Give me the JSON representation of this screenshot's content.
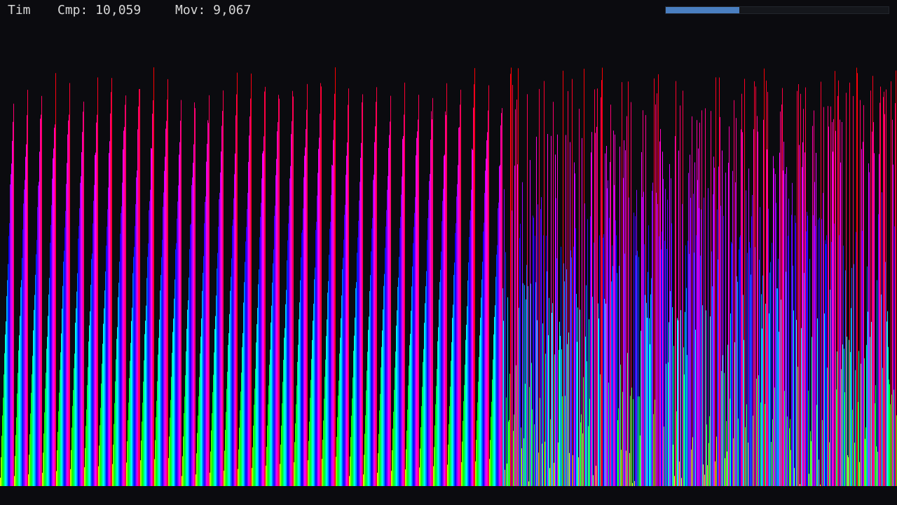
{
  "hud": {
    "algorithm": "Tim",
    "comparisons": "Cmp: 10,059",
    "moves": "Mov: 9,067"
  },
  "progress": {
    "fraction": 0.33,
    "color": "#4a7fc1"
  },
  "visualization": {
    "type": "sort-bars",
    "sorted_runs": 36,
    "unsorted_region_start_fraction": 0.56,
    "colors": {
      "background": "#0b0b0f",
      "palette": "hue-cycle"
    }
  }
}
